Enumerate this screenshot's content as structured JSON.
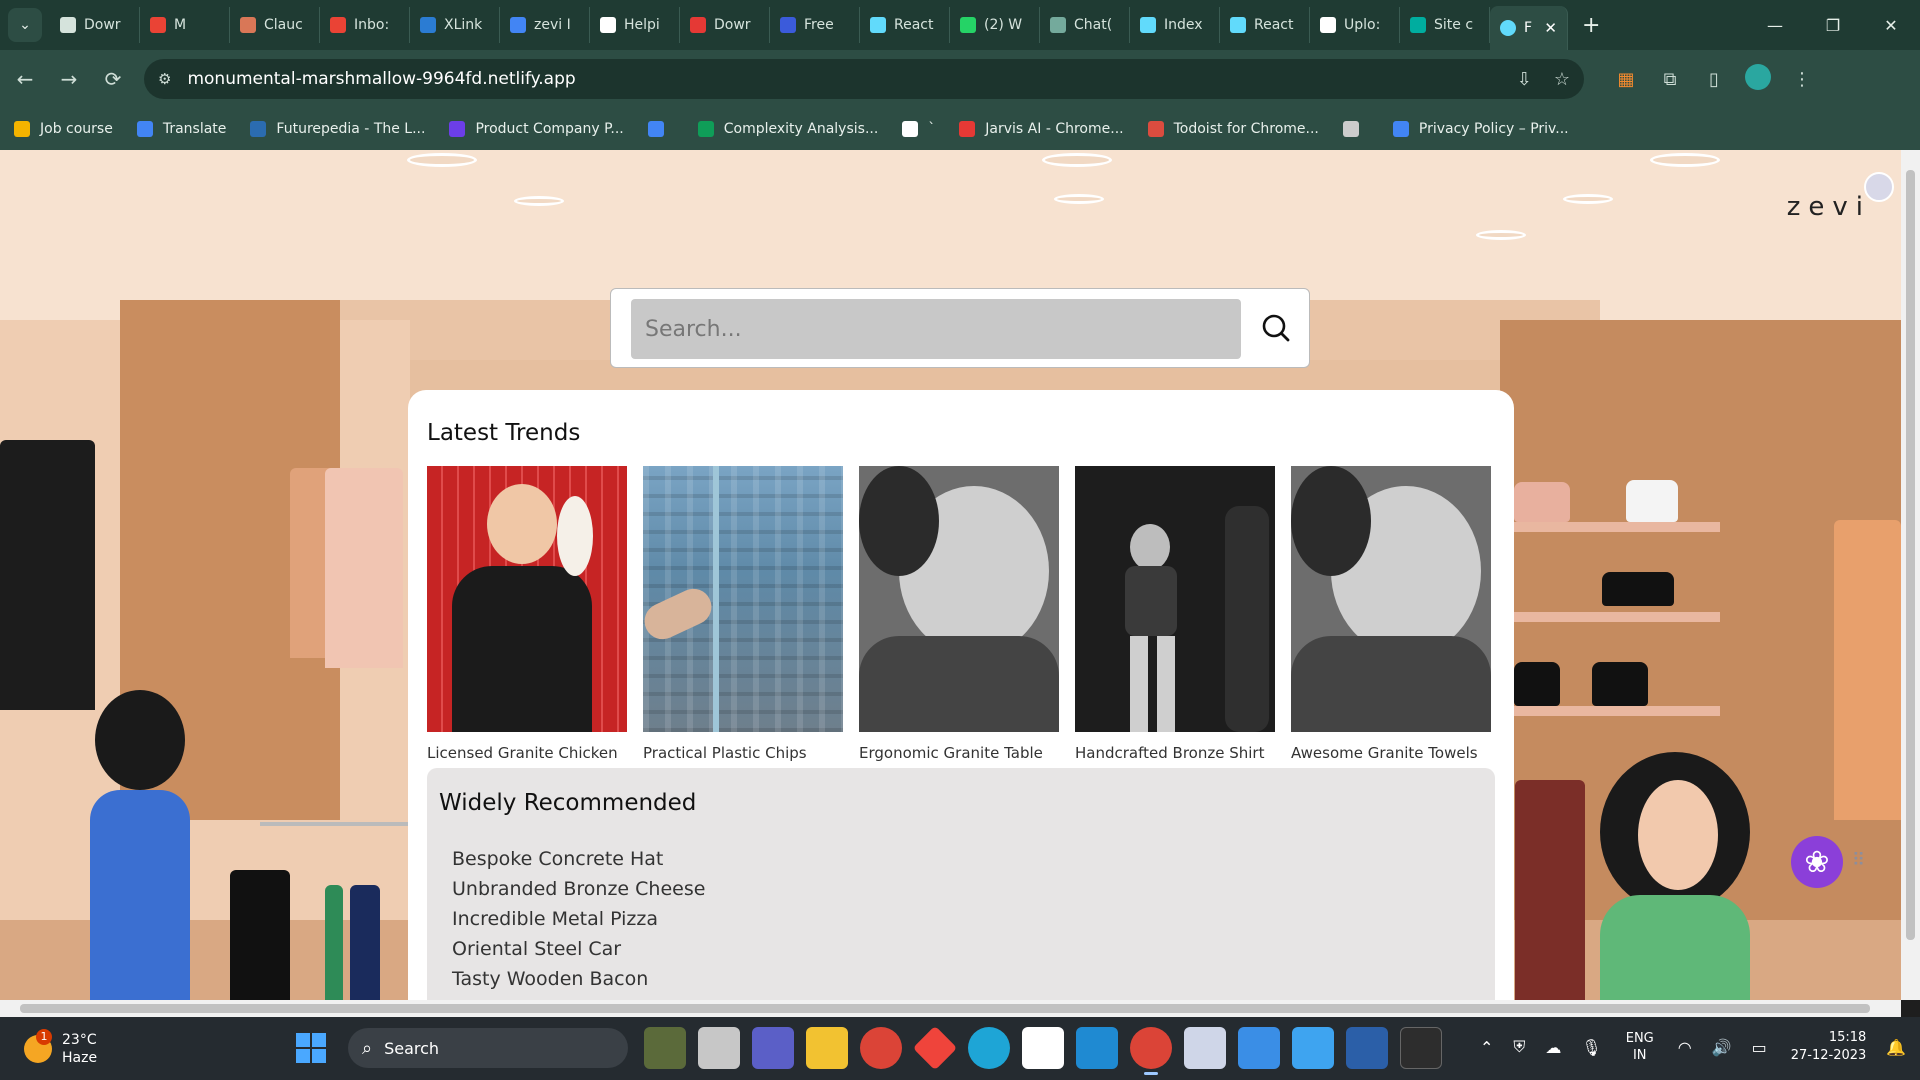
{
  "browser": {
    "tabs": [
      {
        "label": "Dowr",
        "color": "#d5e3dc"
      },
      {
        "label": "M",
        "color": "#ea4335"
      },
      {
        "label": "Clauc",
        "color": "#d97757"
      },
      {
        "label": "Inbo:",
        "color": "#ea4335"
      },
      {
        "label": "XLink",
        "color": "#2b7cd3"
      },
      {
        "label": "zevi I",
        "color": "#4285f4"
      },
      {
        "label": "Helpi",
        "color": "#ffffff"
      },
      {
        "label": "Dowr",
        "color": "#e53935"
      },
      {
        "label": "Free",
        "color": "#3b5bdb"
      },
      {
        "label": "React",
        "color": "#61dafb"
      },
      {
        "label": "(2) W",
        "color": "#25d366"
      },
      {
        "label": "Chat(",
        "color": "#74aa9c"
      },
      {
        "label": "Index",
        "color": "#61dafb"
      },
      {
        "label": "React",
        "color": "#61dafb"
      },
      {
        "label": "Uplo:",
        "color": "#ffffff"
      },
      {
        "label": "Site c",
        "color": "#00ad9f"
      }
    ],
    "active_tab": {
      "label": "F",
      "close": "✕"
    },
    "new_tab": "+",
    "window_controls": {
      "minimize": "—",
      "maximize": "❐",
      "close": "✕"
    },
    "nav": {
      "back": "←",
      "forward": "→",
      "reload": "⟳"
    },
    "url": "monumental-marshmallow-9964fd.netlify.app",
    "bookmarks": [
      {
        "label": "Job course",
        "color": "#f4b400"
      },
      {
        "label": "Translate",
        "color": "#4285f4"
      },
      {
        "label": "Futurepedia - The L...",
        "color": "#2b6cb0"
      },
      {
        "label": "Product Company P...",
        "color": "#6c3ee8"
      },
      {
        "label": "",
        "color": "#4285f4"
      },
      {
        "label": "Complexity Analysis...",
        "color": "#0f9d58"
      },
      {
        "label": "`",
        "color": "#ffffff"
      },
      {
        "label": "Jarvis AI - Chrome...",
        "color": "#e53935"
      },
      {
        "label": "Todoist for Chrome...",
        "color": "#db4c3f"
      },
      {
        "label": "",
        "color": "#cccccc"
      },
      {
        "label": "Privacy Policy – Priv...",
        "color": "#4285f4"
      }
    ]
  },
  "page": {
    "logo": "zevi",
    "search": {
      "placeholder": "Search..."
    },
    "latest_trends": {
      "title": "Latest Trends",
      "products": [
        {
          "name": "Licensed Granite Chicken"
        },
        {
          "name": "Practical Plastic Chips"
        },
        {
          "name": "Ergonomic Granite Table"
        },
        {
          "name": "Handcrafted Bronze Shirt"
        },
        {
          "name": "Awesome Granite Towels"
        }
      ]
    },
    "widely_recommended": {
      "title": "Widely Recommended",
      "items": [
        "Bespoke Concrete Hat",
        "Unbranded Bronze Cheese",
        "Incredible Metal Pizza",
        "Oriental Steel Car",
        "Tasty Wooden Bacon"
      ]
    }
  },
  "taskbar": {
    "weather": {
      "temp": "23°C",
      "condition": "Haze",
      "badge": "1"
    },
    "search_label": "Search",
    "lang": {
      "line1": "ENG",
      "line2": "IN"
    },
    "clock": {
      "time": "15:18",
      "date": "27-12-2023"
    }
  }
}
